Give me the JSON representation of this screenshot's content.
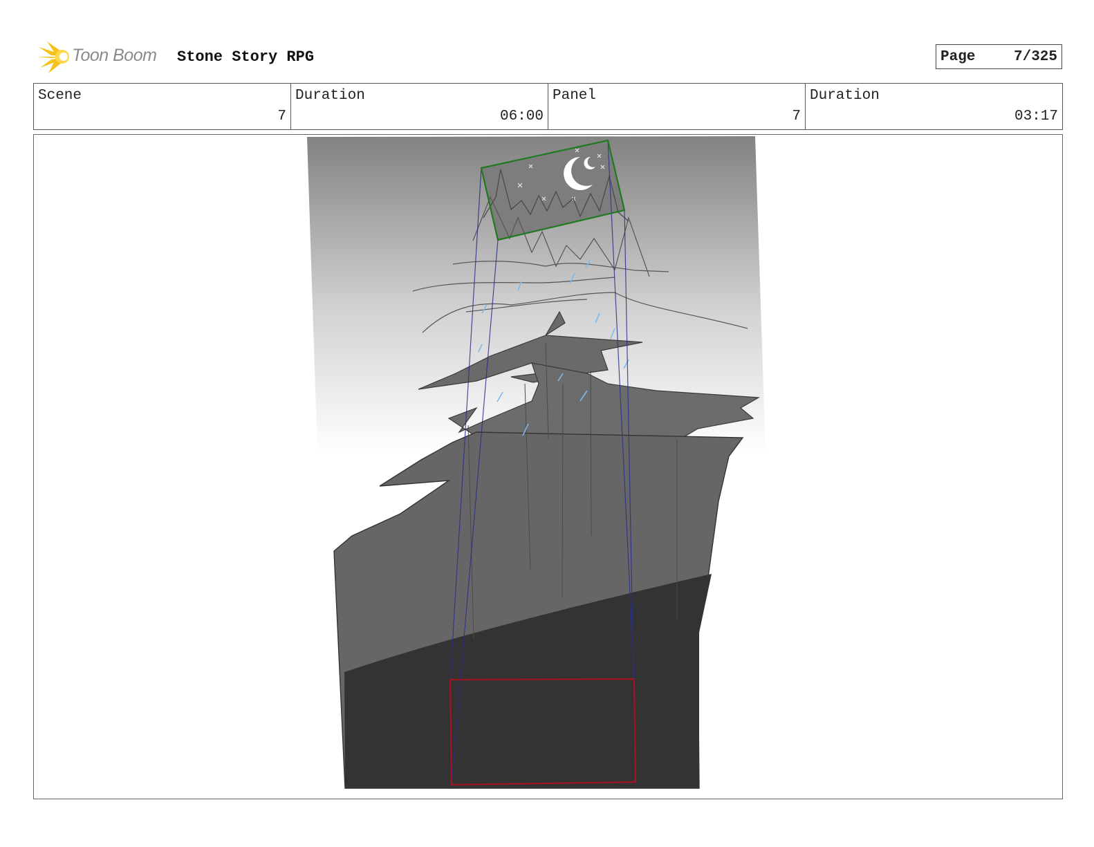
{
  "header": {
    "brand": "Toon Boom",
    "logo_icon": "toon-boom-star-icon",
    "project_title": "Stone Story RPG"
  },
  "page": {
    "label": "Page",
    "value": "7/325"
  },
  "info": {
    "scene_label": "Scene",
    "scene_value": "7",
    "scene_duration_label": "Duration",
    "scene_duration_value": "06:00",
    "panel_label": "Panel",
    "panel_value": "7",
    "panel_duration_label": "Duration",
    "panel_duration_value": "03:17"
  },
  "colors": {
    "camera_start_frame": "#1f7a1f",
    "camera_end_frame": "#a01424",
    "camera_path": "#2a2f8a",
    "rain": "#7fb8ea",
    "cliff_mid": "#666666",
    "cliff_dark": "#333333"
  }
}
